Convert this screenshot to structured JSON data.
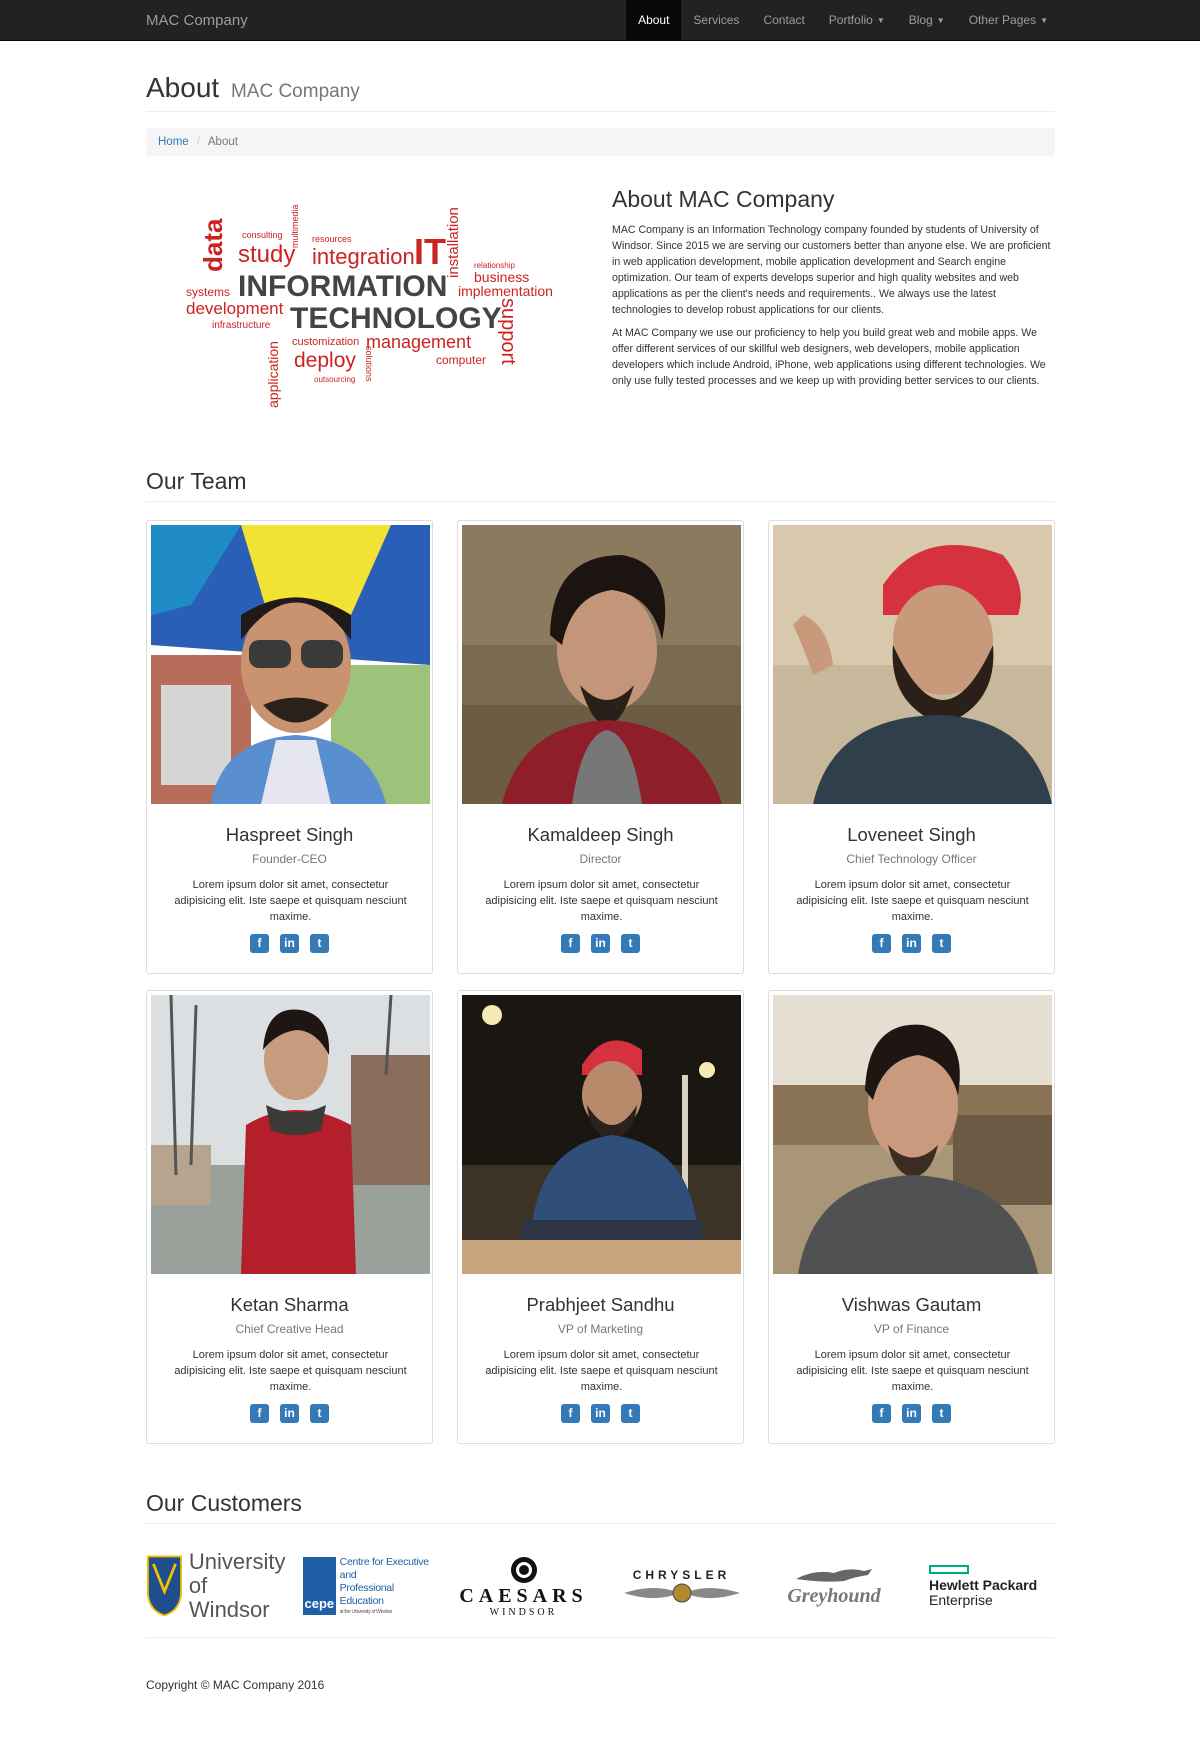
{
  "navbar": {
    "brand": "MAC Company",
    "items": [
      {
        "label": "About",
        "active": true
      },
      {
        "label": "Services"
      },
      {
        "label": "Contact"
      },
      {
        "label": "Portfolio",
        "dropdown": true
      },
      {
        "label": "Blog",
        "dropdown": true
      },
      {
        "label": "Other Pages",
        "dropdown": true
      }
    ]
  },
  "header": {
    "title": "About",
    "subtitle": "MAC Company"
  },
  "breadcrumb": {
    "home": "Home",
    "current": "About"
  },
  "word_cloud": {
    "words": [
      "data",
      "consulting",
      "multimedia",
      "resources",
      "study",
      "integration",
      "IT",
      "installation",
      "relationship",
      "business",
      "systems",
      "INFORMATION",
      "implementation",
      "development",
      "TECHNOLOGY",
      "infrastructure",
      "application",
      "customization",
      "management",
      "support",
      "deploy",
      "solutions",
      "computer",
      "outsourcing"
    ]
  },
  "about": {
    "heading": "About MAC Company",
    "p1": "MAC Company is an Information Technology company founded by students of University of Windsor. Since 2015 we are serving our customers better than anyone else. We are proficient in web application development, mobile application development and Search engine optimization. Our team of experts develops superior and high quality websites and web applications as per the client's needs and requirements.. We always use the latest technologies to develop robust applications for our clients.",
    "p2": "At MAC Company we use our proficiency to help you build great web and mobile apps. We offer different services of our skillful web designers, web developers, mobile application developers which include Android, iPhone, web applications using different technologies. We only use fully tested processes and we keep up with providing better services to our clients."
  },
  "team": {
    "heading": "Our Team",
    "members": [
      {
        "name": "Haspreet Singh",
        "role": "Founder-CEO",
        "desc": "Lorem ipsum dolor sit amet, consectetur adipisicing elit. Iste saepe et quisquam nesciunt maxime."
      },
      {
        "name": "Kamaldeep Singh",
        "role": "Director",
        "desc": "Lorem ipsum dolor sit amet, consectetur adipisicing elit. Iste saepe et quisquam nesciunt maxime."
      },
      {
        "name": "Loveneet Singh",
        "role": "Chief Technology Officer",
        "desc": "Lorem ipsum dolor sit amet, consectetur adipisicing elit. Iste saepe et quisquam nesciunt maxime."
      },
      {
        "name": "Ketan Sharma",
        "role": "Chief Creative Head",
        "desc": "Lorem ipsum dolor sit amet, consectetur adipisicing elit. Iste saepe et quisquam nesciunt maxime."
      },
      {
        "name": "Prabhjeet Sandhu",
        "role": "VP of Marketing",
        "desc": "Lorem ipsum dolor sit amet, consectetur adipisicing elit. Iste saepe et quisquam nesciunt maxime."
      },
      {
        "name": "Vishwas Gautam",
        "role": "VP of Finance",
        "desc": "Lorem ipsum dolor sit amet, consectetur adipisicing elit. Iste saepe et quisquam nesciunt maxime."
      }
    ],
    "social_icons": [
      "facebook-icon",
      "linkedin-icon",
      "twitter-icon"
    ]
  },
  "customers": {
    "heading": "Our Customers",
    "logos": [
      {
        "name": "university-of-windsor-logo",
        "line1": "University",
        "line2": "of Windsor"
      },
      {
        "name": "cepe-logo",
        "mark": "cepe",
        "line1": "Centre for Executive and",
        "line2": "Professional Education",
        "line3": "at the University of Windsor"
      },
      {
        "name": "caesars-windsor-logo",
        "line1": "CAESARS",
        "line2": "WINDSOR"
      },
      {
        "name": "chrysler-logo",
        "line1": "CHRYSLER"
      },
      {
        "name": "greyhound-logo",
        "line1": "Greyhound"
      },
      {
        "name": "hewlett-packard-enterprise-logo",
        "line1": "Hewlett Packard",
        "line2": "Enterprise"
      }
    ]
  },
  "footer": {
    "copyright": "Copyright © MAC Company 2016"
  },
  "colors": {
    "navbar": "#222222",
    "link": "#337ab7",
    "word_red": "#cc2222",
    "word_dark": "#555555"
  }
}
